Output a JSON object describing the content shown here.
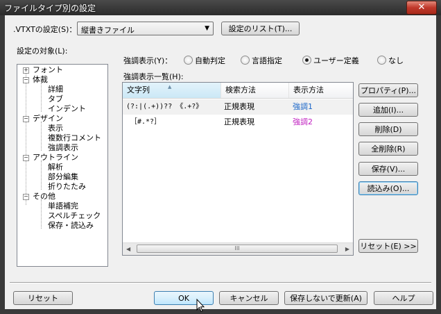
{
  "window": {
    "title": "ファイルタイプ別の設定",
    "close_label": "✕"
  },
  "top": {
    "settings_label": ".VTXTの設定(S)：",
    "filetype_value": "縦書きファイル",
    "list_button": "設定のリスト(T)..."
  },
  "tree": {
    "label": "設定の対象(L):",
    "items": [
      {
        "label": "フォント",
        "expander": "+"
      },
      {
        "label": "体裁",
        "expander": "−"
      },
      {
        "label": "詳細"
      },
      {
        "label": "タブ"
      },
      {
        "label": "インデント"
      },
      {
        "label": "デザイン",
        "expander": "−"
      },
      {
        "label": "表示"
      },
      {
        "label": "複数行コメント"
      },
      {
        "label": "強調表示"
      },
      {
        "label": "アウトライン",
        "expander": "−"
      },
      {
        "label": "解析"
      },
      {
        "label": "部分編集"
      },
      {
        "label": "折りたたみ"
      },
      {
        "label": "その他",
        "expander": "−"
      },
      {
        "label": "単語補完"
      },
      {
        "label": "スペルチェック"
      },
      {
        "label": "保存・読込み"
      }
    ]
  },
  "highlight": {
    "label": "強調表示(Y)：",
    "options": [
      "自動判定",
      "言語指定",
      "ユーザー定義",
      "なし"
    ],
    "selected": "ユーザー定義",
    "list_label": "強調表示一覧(H):"
  },
  "list": {
    "columns": [
      "文字列",
      "検索方法",
      "表示方法"
    ],
    "rows": [
      {
        "pattern": "(?:|(.+))?? 《.+?》",
        "method": "正規表現",
        "display": "強調1",
        "color": "#1a66c8"
      },
      {
        "pattern": "［#.*?］",
        "method": "正規表現",
        "display": "強調2",
        "color": "#c020c0"
      }
    ],
    "scroll_grip": "III"
  },
  "side_buttons": [
    "プロパティ(P)...",
    "追加(I)...",
    "削除(D)",
    "全削除(R)",
    "保存(V)...",
    "読込み(O)...",
    "リセット(E) >>"
  ],
  "bottom_buttons": {
    "reset": "リセット",
    "ok": "OK",
    "cancel": "キャンセル",
    "update_without_save": "保存しないで更新(A)",
    "help": "ヘルプ"
  },
  "colors": {
    "highlight1": "#1a66c8",
    "highlight2": "#c020c0"
  }
}
